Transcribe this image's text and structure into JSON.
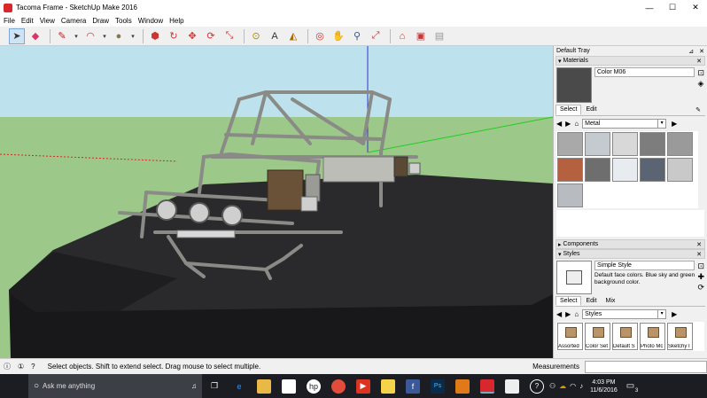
{
  "window": {
    "title": "Tacoma Frame - SketchUp Make 2016",
    "minimize": "—",
    "maximize": "☐",
    "close": "✕"
  },
  "menu": [
    "File",
    "Edit",
    "View",
    "Camera",
    "Draw",
    "Tools",
    "Window",
    "Help"
  ],
  "tray": {
    "title": "Default Tray",
    "materials": {
      "header": "Materials",
      "material_name": "Color M06",
      "tabs": [
        "Select",
        "Edit"
      ],
      "library": "Metal",
      "swatch_colors": [
        "#a9a9a9",
        "#c5cad0",
        "#d8d8d8",
        "#7d7d7d",
        "#9a9a9a",
        "#b5613f",
        "#6e6e6e",
        "#e8ebef",
        "#5a6472",
        "#c9c9c9",
        "#b8bcc0"
      ]
    },
    "components": {
      "header": "Components"
    },
    "styles": {
      "header": "Styles",
      "style_name": "Simple Style",
      "description": "Default face colors. Blue sky and green background color.",
      "tabs": [
        "Select",
        "Edit",
        "Mix"
      ],
      "library": "Styles",
      "thumbs": [
        "Assorted",
        "Color Set",
        "Default S",
        "Photo Mc",
        "Sketchy I"
      ]
    }
  },
  "status": {
    "hint": "Select objects. Shift to extend select. Drag mouse to select multiple.",
    "measurements_label": "Measurements"
  },
  "taskbar": {
    "search_placeholder": "Ask me anything",
    "time": "4:03 PM",
    "date": "11/6/2016",
    "notif_count": "3"
  },
  "colors": {
    "sky": "#bde1ed",
    "ground": "#9cc98a",
    "terrain": "#2a2a2c",
    "frame": "#8a8a86",
    "axis_red": "#d22",
    "axis_green": "#2c2",
    "axis_blue": "#33c"
  }
}
